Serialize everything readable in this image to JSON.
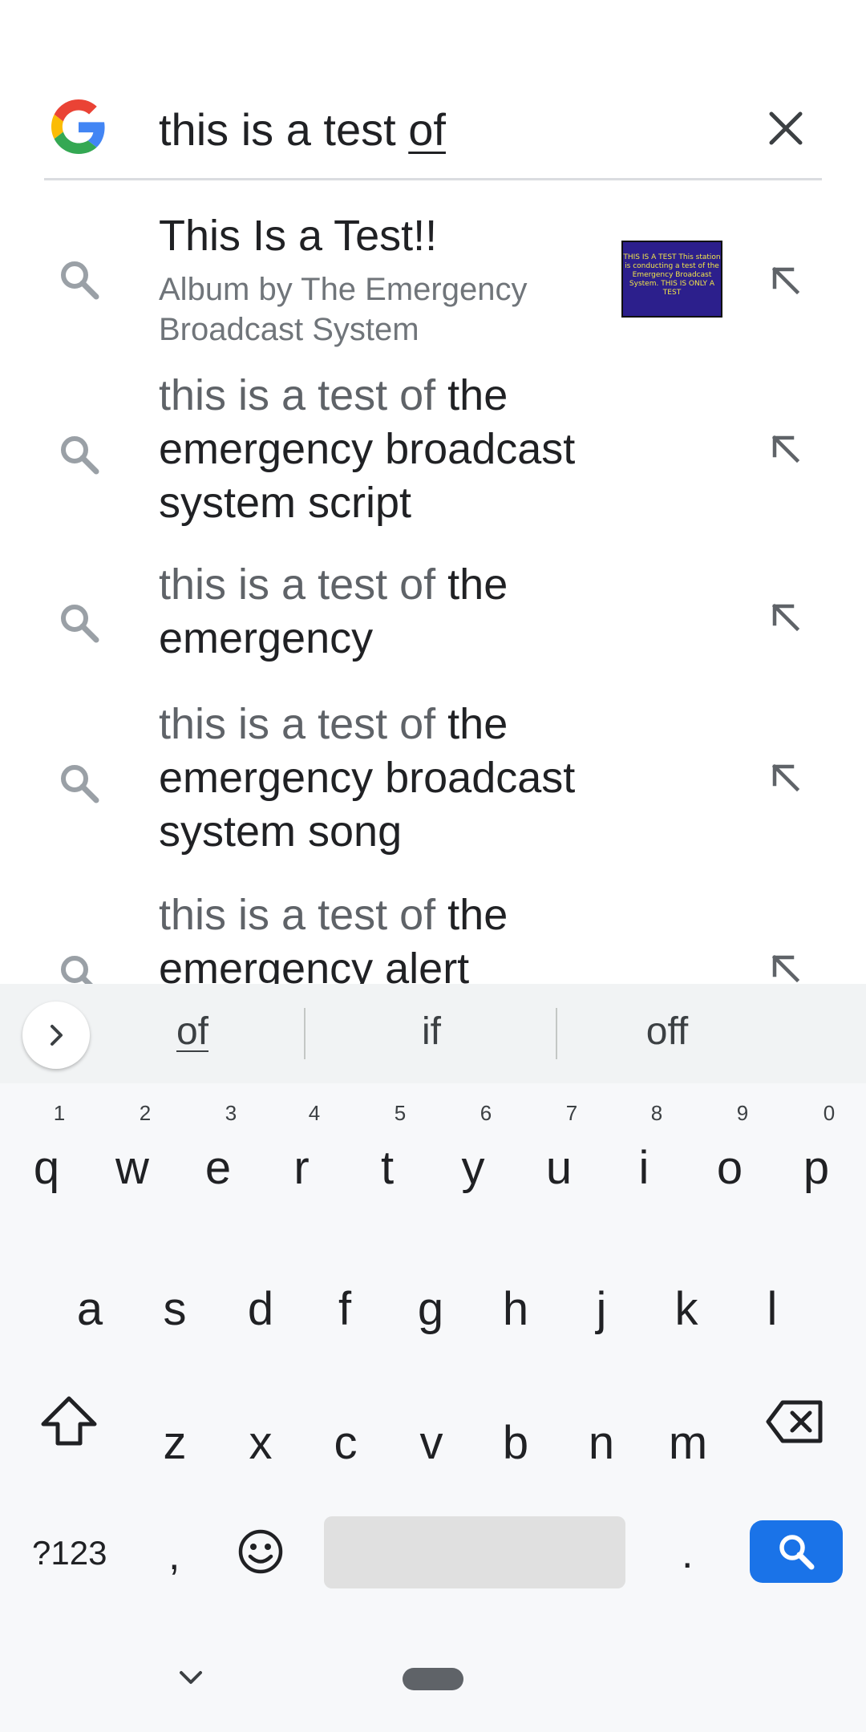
{
  "search": {
    "query_prefix": "this is a test ",
    "query_composing": "of",
    "logo_icon": "google-g-icon",
    "clear_icon": "close-icon"
  },
  "suggestions": [
    {
      "type": "rich",
      "title": "This Is a Test!!",
      "subtitle": "Album by The Emergency Broadcast System",
      "thumbnail_text": "THIS IS A TEST This station is conducting a test of the Emergency Broadcast System. THIS IS ONLY A TEST",
      "icon": "search-icon",
      "fill_icon": "arrow-up-left-icon"
    },
    {
      "type": "query",
      "prefix": "this is a test of",
      "completion": "the emergency broadcast system script",
      "icon": "search-icon",
      "fill_icon": "arrow-up-left-icon"
    },
    {
      "type": "query",
      "prefix": "this is a test of",
      "completion": "the emergency",
      "icon": "search-icon",
      "fill_icon": "arrow-up-left-icon"
    },
    {
      "type": "query",
      "prefix": "this is a test of",
      "completion": "the emergency broadcast system song",
      "icon": "search-icon",
      "fill_icon": "arrow-up-left-icon"
    },
    {
      "type": "query",
      "prefix": "this is a test of",
      "completion": "the emergency alert system",
      "icon": "search-icon",
      "fill_icon": "arrow-up-left-icon"
    }
  ],
  "keyboard": {
    "word_suggestions": [
      "of",
      "if",
      "off"
    ],
    "row1": [
      {
        "letter": "q",
        "digit": "1"
      },
      {
        "letter": "w",
        "digit": "2"
      },
      {
        "letter": "e",
        "digit": "3"
      },
      {
        "letter": "r",
        "digit": "4"
      },
      {
        "letter": "t",
        "digit": "5"
      },
      {
        "letter": "y",
        "digit": "6"
      },
      {
        "letter": "u",
        "digit": "7"
      },
      {
        "letter": "i",
        "digit": "8"
      },
      {
        "letter": "o",
        "digit": "9"
      },
      {
        "letter": "p",
        "digit": "0"
      }
    ],
    "row2": [
      "a",
      "s",
      "d",
      "f",
      "g",
      "h",
      "j",
      "k",
      "l"
    ],
    "row3": [
      "z",
      "x",
      "c",
      "v",
      "b",
      "n",
      "m"
    ],
    "symbols_label": "?123",
    "comma_label": ",",
    "period_label": ".",
    "accent_color": "#1a73e8"
  }
}
